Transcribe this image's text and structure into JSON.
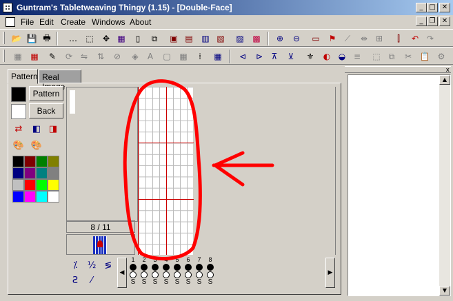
{
  "window": {
    "title": "Guntram's Tabletweaving Thingy (1.15) - [Double-Face]",
    "minimize": "_",
    "maximize": "□",
    "close": "✕"
  },
  "menu": {
    "items": [
      "File",
      "Edit",
      "Create",
      "Windows",
      "About"
    ]
  },
  "mdi": {
    "minimize": "_",
    "restore": "❐",
    "close": "✕"
  },
  "tabs": [
    "Pattern",
    "Real Image"
  ],
  "buttons": {
    "pattern": "Pattern",
    "back": "Back"
  },
  "colors": {
    "foreground": "#000000",
    "background": "#ffffff",
    "palette": [
      "#000000",
      "#800000",
      "#008000",
      "#808000",
      "#000080",
      "#800080",
      "#008080",
      "#808080",
      "#c0c0c0",
      "#ff0000",
      "#00ff00",
      "#ffff00",
      "#0000ff",
      "#ff00ff",
      "#00ffff",
      "#ffffff"
    ],
    "annotation": "#ff0000"
  },
  "counter": "8 / 11",
  "cards": {
    "numbers": [
      "1",
      "2",
      "3",
      "4",
      "5",
      "6",
      "7",
      "8"
    ],
    "directions": [
      "S",
      "S",
      "S",
      "S",
      "S",
      "S",
      "S",
      "S"
    ]
  },
  "scroll": {
    "left": "◀",
    "right": "▶",
    "up": "▲",
    "down": "▼"
  },
  "right_panel": {
    "close": "x"
  }
}
